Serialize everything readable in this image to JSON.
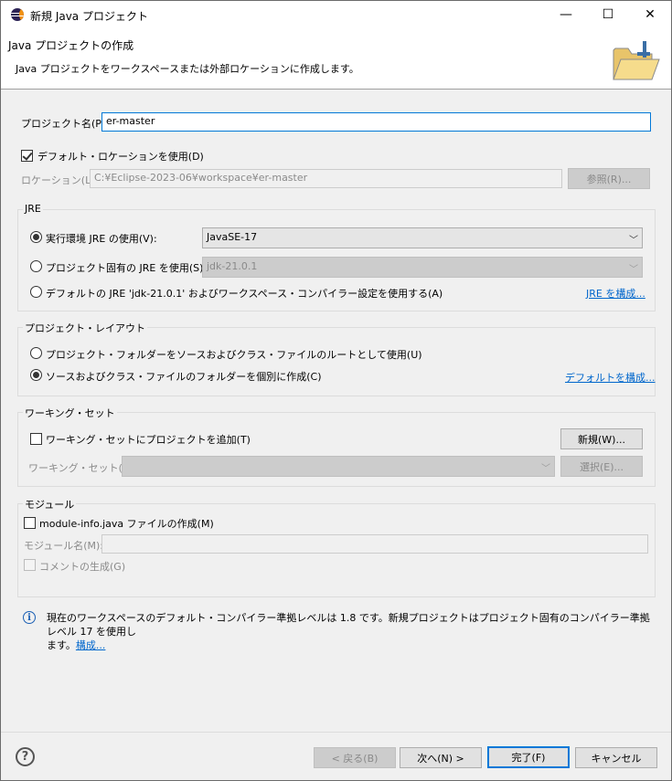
{
  "window": {
    "title": "新規 Java プロジェクト",
    "minimize": "—",
    "maximize": "☐",
    "close": "✕"
  },
  "header": {
    "title": "Java プロジェクトの作成",
    "description": "Java プロジェクトをワークスペースまたは外部ロケーションに作成します。",
    "icon": "new-folder-icon"
  },
  "project": {
    "name_label": "プロジェクト名(P):",
    "name_value": "er-master",
    "default_location_label": "デフォルト・ロケーションを使用(D)",
    "default_location_checked": true,
    "location_label": "ロケーション(L):",
    "location_value": "C:¥Eclipse-2023-06¥workspace¥er-master",
    "browse_label": "参照(R)..."
  },
  "jre": {
    "group_title": "JRE",
    "option_env_label": "実行環境 JRE の使用(V):",
    "option_env_value": "JavaSE-17",
    "option_project_label": "プロジェクト固有の JRE を使用(S):",
    "option_project_value": "jdk-21.0.1",
    "option_default_label": "デフォルトの JRE 'jdk-21.0.1' およびワークスペース・コンパイラー設定を使用する(A)",
    "configure_link": "JRE を構成...",
    "selected": "env"
  },
  "layout": {
    "group_title": "プロジェクト・レイアウト",
    "option_root_label": "プロジェクト・フォルダーをソースおよびクラス・ファイルのルートとして使用(U)",
    "option_separate_label": "ソースおよびクラス・ファイルのフォルダーを個別に作成(C)",
    "configure_link": "デフォルトを構成...",
    "selected": "separate"
  },
  "working_set": {
    "group_title": "ワーキング・セット",
    "add_label": "ワーキング・セットにプロジェクトを追加(T)",
    "add_checked": false,
    "new_button": "新規(W)...",
    "sets_label": "ワーキング・セット(O):",
    "select_button": "選択(E)..."
  },
  "module": {
    "group_title": "モジュール",
    "create_label": "module-info.java ファイルの作成(M)",
    "create_checked": false,
    "name_label": "モジュール名(M):",
    "comment_label": "コメントの生成(G)"
  },
  "info": {
    "message": "現在のワークスペースのデフォルト・コンパイラー準拠レベルは 1.8 です。新規プロジェクトはプロジェクト固有のコンパイラー準拠レベル 17 を使用します。",
    "message_line1": "現在のワークスペースのデフォルト・コンパイラー準拠レベルは 1.8 です。新規プロジェクトはプロジェクト固有のコンパイラー準拠レベル 17 を使用し",
    "message_line2": "ます。",
    "link": "構成..."
  },
  "footer": {
    "help": "?",
    "back": "< 戻る(B)",
    "next": "次へ(N) >",
    "finish": "完了(F)",
    "cancel": "キャンセル"
  }
}
